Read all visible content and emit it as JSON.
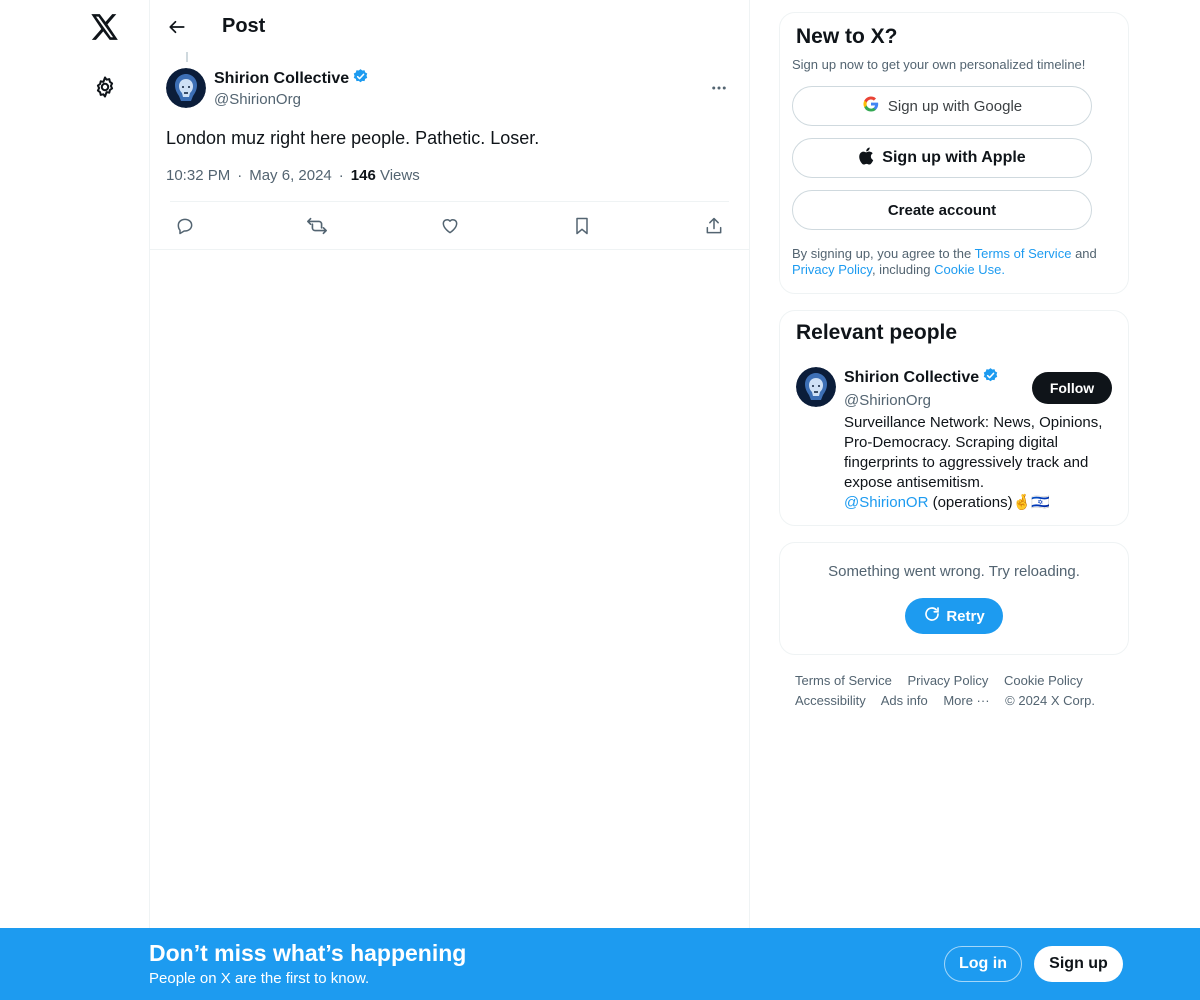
{
  "app": {
    "logo_icon": "x-logo-icon",
    "settings_icon": "gear-icon"
  },
  "header": {
    "title": "Post"
  },
  "tweet": {
    "author_name": "Shirion Collective",
    "author_handle": "@ShirionOrg",
    "verified": true,
    "text": "London muz right here people. Pathetic. Loser.",
    "time": "10:32 PM",
    "date": "May 6, 2024",
    "views_count": "146",
    "views_label": "Views",
    "separator": "·"
  },
  "signup": {
    "title": "New to X?",
    "subtitle": "Sign up now to get your own personalized timeline!",
    "google_label": "Sign up with Google",
    "apple_label": "Sign up with Apple",
    "create_label": "Create account",
    "legal_prefix": "By signing up, you agree to the",
    "terms_link": "Terms of Service",
    "and": "and",
    "privacy_link": "Privacy Policy",
    "including": ", including",
    "cookie_link": "Cookie Use."
  },
  "relevant": {
    "title": "Relevant people",
    "name": "Shirion Collective",
    "handle": "@ShirionOrg",
    "follow_label": "Follow",
    "bio": "Surveillance Network: News, Opinions, Pro-Democracy. Scraping digital fingerprints to aggressively track and expose antisemitism.",
    "bio_link": "@ShirionOR",
    "bio_suffix": "(operations)🤞🇮🇱"
  },
  "error_card": {
    "message": "Something went wrong. Try reloading.",
    "retry_label": "Retry"
  },
  "footer": {
    "terms": "Terms of Service",
    "privacy": "Privacy Policy",
    "cookie": "Cookie Policy",
    "accessibility": "Accessibility",
    "ads": "Ads info",
    "more": "More ···",
    "copyright": "© 2024 X Corp."
  },
  "bottom_bar": {
    "title": "Don’t miss what’s happening",
    "subtitle": "People on X are the first to know.",
    "login_label": "Log in",
    "signup_label": "Sign up"
  },
  "colors": {
    "accent": "#1d9bf0",
    "text": "#0f1419",
    "muted": "#536471",
    "border": "#eff3f4"
  }
}
